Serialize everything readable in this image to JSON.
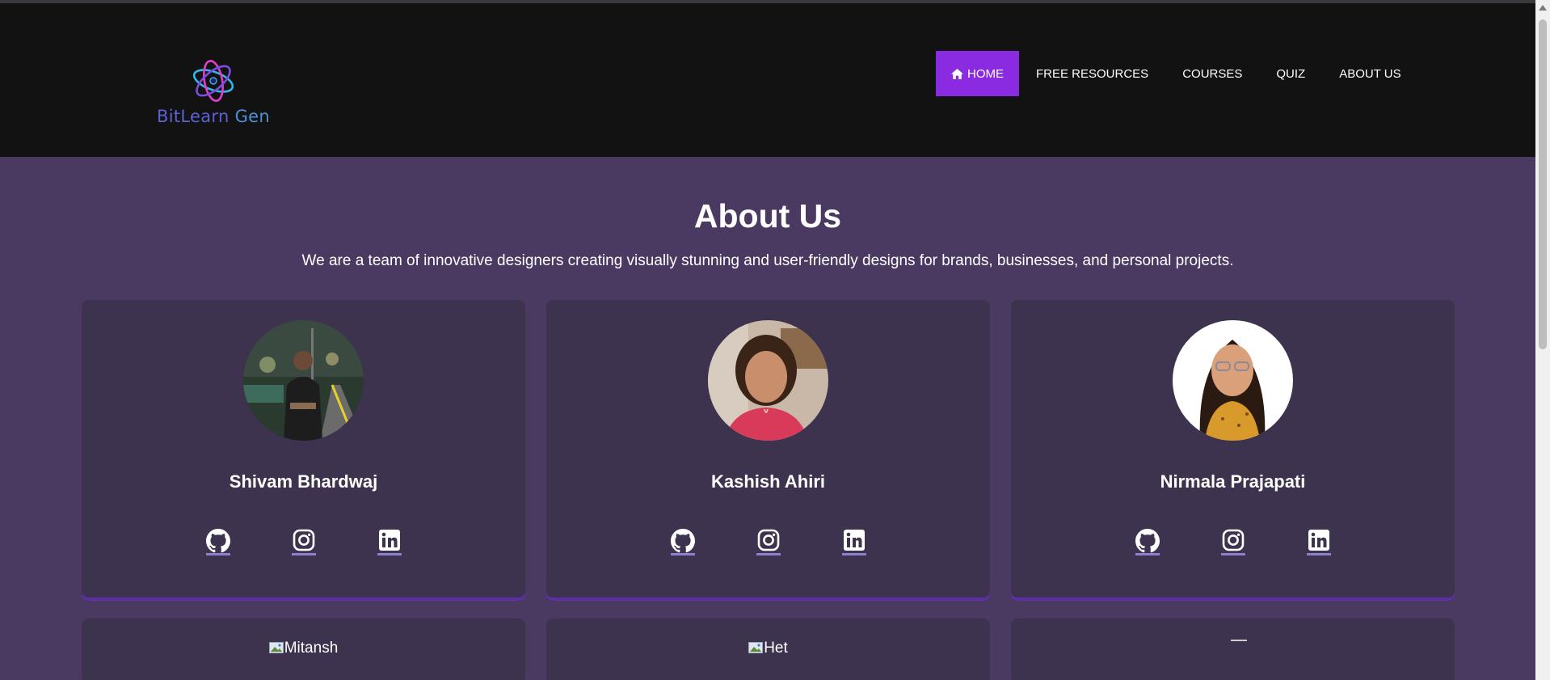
{
  "brand": {
    "part1": "BitLearn",
    "part2": " Gen"
  },
  "nav": {
    "items": [
      {
        "label": "HOME",
        "icon": "home-icon",
        "active": true
      },
      {
        "label": "FREE RESOURCES"
      },
      {
        "label": "COURSES"
      },
      {
        "label": "QUIZ"
      },
      {
        "label": "ABOUT US"
      }
    ]
  },
  "about": {
    "title": "About Us",
    "subtitle": "We are a team of innovative designers creating visually stunning and user-friendly designs for brands, businesses, and personal projects."
  },
  "team": [
    {
      "name": "Shivam Bhardwaj",
      "socials": [
        "github-icon",
        "instagram-icon",
        "linkedin-icon"
      ]
    },
    {
      "name": "Kashish Ahiri",
      "socials": [
        "github-icon",
        "instagram-icon",
        "linkedin-icon"
      ]
    },
    {
      "name": "Nirmala Prajapati",
      "socials": [
        "github-icon",
        "instagram-icon",
        "linkedin-icon"
      ]
    }
  ],
  "team_row2": [
    {
      "alt": "Mitansh"
    },
    {
      "alt": "Het"
    },
    {
      "alt": ""
    }
  ],
  "colors": {
    "header_bg": "#121212",
    "page_bg": "#4a3a62",
    "card_bg": "#3e334e",
    "accent": "#8a2be2",
    "card_shadow": "#5c2fa5"
  }
}
